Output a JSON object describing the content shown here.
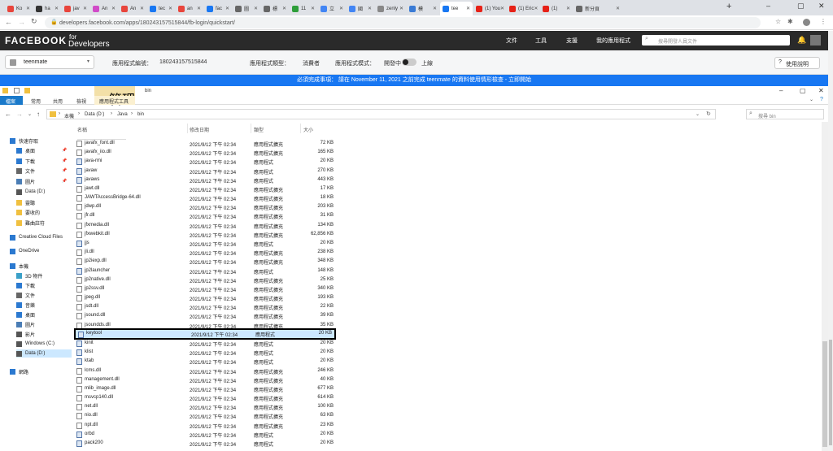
{
  "browser": {
    "tabs": [
      {
        "label": "Ko"
      },
      {
        "label": "ha"
      },
      {
        "label": "jav"
      },
      {
        "label": "An"
      },
      {
        "label": "An"
      },
      {
        "label": "tec"
      },
      {
        "label": "an"
      },
      {
        "label": "fac"
      },
      {
        "label": "圖"
      },
      {
        "label": "標"
      },
      {
        "label": "11"
      },
      {
        "label": "立"
      },
      {
        "label": "國"
      },
      {
        "label": "zenly"
      },
      {
        "label": "模"
      },
      {
        "label": "tee"
      },
      {
        "label": "(1) You"
      },
      {
        "label": "(1) Eric"
      },
      {
        "label": "(1)"
      },
      {
        "label": "新分頁"
      }
    ],
    "url": "developers.facebook.com/apps/180243157515844/fb-login/quickstart/"
  },
  "fb": {
    "logo_main": "FACEBOOK",
    "logo_for": "for",
    "logo_dev": "Developers",
    "nav": [
      "文件",
      "工具",
      "支援",
      "我的應用程式"
    ],
    "search_placeholder": "搜尋開發人員文件",
    "app_name": "teenmate",
    "app_id_label": "應用程式編號：",
    "app_id": "180243157515844",
    "app_type_label": "應用程式類型：",
    "app_type": "消費者",
    "app_mode_label": "應用程式模式：",
    "app_mode_dev": "開發中",
    "app_mode_live": "上線",
    "help": "使用說明",
    "banner": "必須完成事項： 請在 November 11, 2021 之前完成 teenmate 的資料使用情形檢查 - 立即開始"
  },
  "explorer": {
    "title": "bin",
    "manage_tab": "管理",
    "ribbon_tabs": [
      "檔案",
      "常用",
      "共用",
      "檢視",
      "應用程式工具"
    ],
    "path": [
      "本機",
      "Data (D:)",
      "Java",
      "bin"
    ],
    "search_placeholder": "搜尋 bin",
    "columns": {
      "name": "名稱",
      "date": "修改日期",
      "type": "類型",
      "size": "大小"
    },
    "nav": [
      {
        "label": "快速存取",
        "icon": "star-icon"
      },
      {
        "label": "桌面",
        "icon": "desktop-icon"
      },
      {
        "label": "下載",
        "icon": "download-icon"
      },
      {
        "label": "文件",
        "icon": "document-icon"
      },
      {
        "label": "圖片",
        "icon": "picture-icon"
      },
      {
        "label": "Data (D:)",
        "icon": "drive-icon"
      },
      {
        "label": "靈聽",
        "icon": "folder-icon"
      },
      {
        "label": "要收的",
        "icon": "folder-icon"
      },
      {
        "label": "難曲註符",
        "icon": "folder-icon"
      },
      {
        "label": "Creative Cloud Files",
        "icon": "cloud-icon"
      },
      {
        "label": "OneDrive",
        "icon": "cloud-icon"
      },
      {
        "label": "本機",
        "icon": "computer-icon"
      },
      {
        "label": "3D 物件",
        "icon": "cube-icon"
      },
      {
        "label": "下載",
        "icon": "download-icon"
      },
      {
        "label": "文件",
        "icon": "document-icon"
      },
      {
        "label": "音樂",
        "icon": "music-icon"
      },
      {
        "label": "桌面",
        "icon": "desktop-icon"
      },
      {
        "label": "圖片",
        "icon": "picture-icon"
      },
      {
        "label": "影片",
        "icon": "video-icon"
      },
      {
        "label": "Windows (C:)",
        "icon": "drive-icon"
      },
      {
        "label": "Data (D:)",
        "icon": "drive-icon"
      },
      {
        "label": "網路",
        "icon": "network-icon"
      }
    ],
    "files": [
      {
        "name": "javafx_font.dll",
        "date": "2021/9/12 下午 02:34",
        "type": "應用程式擴充",
        "size": "72 KB",
        "kind": "dll"
      },
      {
        "name": "javafx_iio.dll",
        "date": "2021/9/12 下午 02:34",
        "type": "應用程式擴充",
        "size": "165 KB",
        "kind": "dll"
      },
      {
        "name": "java-rmi",
        "date": "2021/9/12 下午 02:34",
        "type": "應用程式",
        "size": "20 KB",
        "kind": "exe"
      },
      {
        "name": "javaw",
        "date": "2021/9/12 下午 02:34",
        "type": "應用程式",
        "size": "270 KB",
        "kind": "exe"
      },
      {
        "name": "javaws",
        "date": "2021/9/12 下午 02:34",
        "type": "應用程式",
        "size": "443 KB",
        "kind": "exe"
      },
      {
        "name": "jawt.dll",
        "date": "2021/9/12 下午 02:34",
        "type": "應用程式擴充",
        "size": "17 KB",
        "kind": "dll"
      },
      {
        "name": "JAWTAccessBridge-64.dll",
        "date": "2021/9/12 下午 02:34",
        "type": "應用程式擴充",
        "size": "18 KB",
        "kind": "dll"
      },
      {
        "name": "jdwp.dll",
        "date": "2021/9/12 下午 02:34",
        "type": "應用程式擴充",
        "size": "203 KB",
        "kind": "dll"
      },
      {
        "name": "jfr.dll",
        "date": "2021/9/12 下午 02:34",
        "type": "應用程式擴充",
        "size": "31 KB",
        "kind": "dll"
      },
      {
        "name": "jfxmedia.dll",
        "date": "2021/9/12 下午 02:34",
        "type": "應用程式擴充",
        "size": "134 KB",
        "kind": "dll"
      },
      {
        "name": "jfxwebkit.dll",
        "date": "2021/9/12 下午 02:34",
        "type": "應用程式擴充",
        "size": "62,856 KB",
        "kind": "dll"
      },
      {
        "name": "jjs",
        "date": "2021/9/12 下午 02:34",
        "type": "應用程式",
        "size": "20 KB",
        "kind": "exe"
      },
      {
        "name": "jli.dll",
        "date": "2021/9/12 下午 02:34",
        "type": "應用程式擴充",
        "size": "238 KB",
        "kind": "dll"
      },
      {
        "name": "jp2iexp.dll",
        "date": "2021/9/12 下午 02:34",
        "type": "應用程式擴充",
        "size": "348 KB",
        "kind": "dll"
      },
      {
        "name": "jp2launcher",
        "date": "2021/9/12 下午 02:34",
        "type": "應用程式",
        "size": "148 KB",
        "kind": "exe"
      },
      {
        "name": "jp2native.dll",
        "date": "2021/9/12 下午 02:34",
        "type": "應用程式擴充",
        "size": "25 KB",
        "kind": "dll"
      },
      {
        "name": "jp2ssv.dll",
        "date": "2021/9/12 下午 02:34",
        "type": "應用程式擴充",
        "size": "340 KB",
        "kind": "dll"
      },
      {
        "name": "jpeg.dll",
        "date": "2021/9/12 下午 02:34",
        "type": "應用程式擴充",
        "size": "193 KB",
        "kind": "dll"
      },
      {
        "name": "jsdt.dll",
        "date": "2021/9/12 下午 02:34",
        "type": "應用程式擴充",
        "size": "22 KB",
        "kind": "dll"
      },
      {
        "name": "jsound.dll",
        "date": "2021/9/12 下午 02:34",
        "type": "應用程式擴充",
        "size": "39 KB",
        "kind": "dll"
      },
      {
        "name": "jsoundds.dll",
        "date": "2021/9/12 下午 02:34",
        "type": "應用程式擴充",
        "size": "35 KB",
        "kind": "dll"
      },
      {
        "name": "keytool",
        "date": "2021/9/12 下午 02:34",
        "type": "應用程式",
        "size": "20 KB",
        "kind": "exe"
      },
      {
        "name": "kinit",
        "date": "2021/9/12 下午 02:34",
        "type": "應用程式",
        "size": "20 KB",
        "kind": "exe"
      },
      {
        "name": "klist",
        "date": "2021/9/12 下午 02:34",
        "type": "應用程式",
        "size": "20 KB",
        "kind": "exe"
      },
      {
        "name": "ktab",
        "date": "2021/9/12 下午 02:34",
        "type": "應用程式",
        "size": "20 KB",
        "kind": "exe"
      },
      {
        "name": "lcms.dll",
        "date": "2021/9/12 下午 02:34",
        "type": "應用程式擴充",
        "size": "246 KB",
        "kind": "dll"
      },
      {
        "name": "management.dll",
        "date": "2021/9/12 下午 02:34",
        "type": "應用程式擴充",
        "size": "40 KB",
        "kind": "dll"
      },
      {
        "name": "mlib_image.dll",
        "date": "2021/9/12 下午 02:34",
        "type": "應用程式擴充",
        "size": "677 KB",
        "kind": "dll"
      },
      {
        "name": "msvcp140.dll",
        "date": "2021/9/12 下午 02:34",
        "type": "應用程式擴充",
        "size": "614 KB",
        "kind": "dll"
      },
      {
        "name": "net.dll",
        "date": "2021/9/12 下午 02:34",
        "type": "應用程式擴充",
        "size": "100 KB",
        "kind": "dll"
      },
      {
        "name": "nio.dll",
        "date": "2021/9/12 下午 02:34",
        "type": "應用程式擴充",
        "size": "63 KB",
        "kind": "dll"
      },
      {
        "name": "npt.dll",
        "date": "2021/9/12 下午 02:34",
        "type": "應用程式擴充",
        "size": "23 KB",
        "kind": "dll"
      },
      {
        "name": "orbd",
        "date": "2021/9/12 下午 02:34",
        "type": "應用程式",
        "size": "20 KB",
        "kind": "exe"
      },
      {
        "name": "pack200",
        "date": "2021/9/12 下午 02:34",
        "type": "應用程式",
        "size": "20 KB",
        "kind": "exe"
      }
    ],
    "highlighted_file": "keytool"
  },
  "colors": {
    "fb_blue": "#1877f2",
    "fb_dark": "#2a2a2a",
    "manage_tab": "#f3e0a8",
    "highlight_border": "#000000"
  }
}
